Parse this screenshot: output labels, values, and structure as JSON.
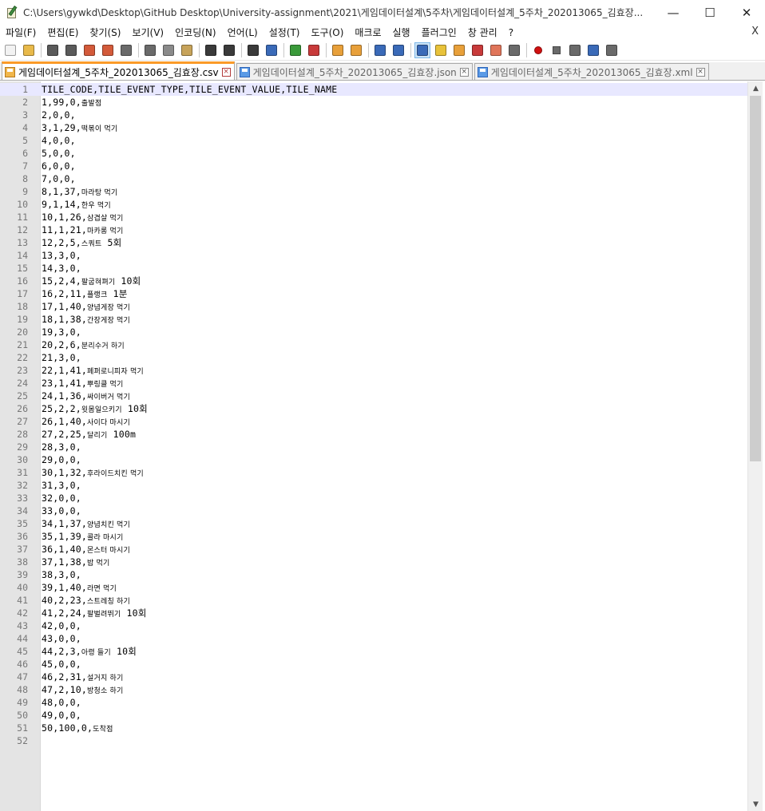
{
  "window": {
    "title": "C:\\Users\\gywkd\\Desktop\\GitHub Desktop\\University-assignment\\2021\\게임데이터설계\\5주차\\게임데이터설계_5주차_202013065_김효장...",
    "minimize": "—",
    "maximize": "☐",
    "close": "✕"
  },
  "menu": {
    "items": [
      "파일(F)",
      "편집(E)",
      "찾기(S)",
      "보기(V)",
      "인코딩(N)",
      "언어(L)",
      "설정(T)",
      "도구(O)",
      "매크로",
      "실행",
      "플러그인",
      "창 관리",
      "?"
    ],
    "close": "X"
  },
  "toolbar": {
    "buttons": [
      {
        "icon": "new-file-icon",
        "color": "#f2f2f2"
      },
      {
        "icon": "open-folder-icon",
        "color": "#e8b94a"
      },
      {
        "icon": "save-icon",
        "color": "#5a5a5a"
      },
      {
        "icon": "save-all-icon",
        "color": "#5a5a5a"
      },
      {
        "icon": "close-file-icon",
        "color": "#d35a3a"
      },
      {
        "icon": "close-all-icon",
        "color": "#d35a3a"
      },
      {
        "icon": "print-icon",
        "color": "#6a6a6a"
      },
      {
        "icon": "cut-icon",
        "color": "#6a6a6a"
      },
      {
        "icon": "copy-icon",
        "color": "#8a8a8a"
      },
      {
        "icon": "paste-icon",
        "color": "#c7a35a"
      },
      {
        "icon": "undo-icon",
        "color": "#3a3a3a"
      },
      {
        "icon": "redo-icon",
        "color": "#3a3a3a"
      },
      {
        "icon": "find-icon",
        "color": "#3a3a3a"
      },
      {
        "icon": "replace-icon",
        "color": "#3a6ab8"
      },
      {
        "icon": "zoom-in-icon",
        "color": "#3a9a3a"
      },
      {
        "icon": "zoom-out-icon",
        "color": "#c83a3a"
      },
      {
        "icon": "sync-vertical-icon",
        "color": "#e8a03a"
      },
      {
        "icon": "sync-horizontal-icon",
        "color": "#e8a03a"
      },
      {
        "icon": "word-wrap-icon",
        "color": "#3a6ab8"
      },
      {
        "icon": "all-characters-icon",
        "color": "#3a6ab8"
      },
      {
        "icon": "indent-guide-icon",
        "color": "#3a6ab8",
        "active": true
      },
      {
        "icon": "user-language-icon",
        "color": "#e8c23a"
      },
      {
        "icon": "document-map-icon",
        "color": "#e8a03a"
      },
      {
        "icon": "function-list-icon",
        "color": "#c83a3a"
      },
      {
        "icon": "folder-workspace-icon",
        "color": "#e0755a"
      },
      {
        "icon": "monitoring-icon",
        "color": "#6a6a6a"
      },
      {
        "icon": "record-macro-icon",
        "color": "#d01010"
      },
      {
        "icon": "stop-record-icon",
        "color": "#6a6a6a"
      },
      {
        "icon": "play-macro-icon",
        "color": "#6a6a6a"
      },
      {
        "icon": "run-macro-multiple-icon",
        "color": "#3a6ab8"
      },
      {
        "icon": "save-macro-icon",
        "color": "#6a6a6a"
      }
    ]
  },
  "tabs": [
    {
      "label": "게임데이터설계_5주차_202013065_김효장.csv",
      "active": true
    },
    {
      "label": "게임데이터설계_5주차_202013065_김효장.json",
      "active": false
    },
    {
      "label": "게임데이터설계_5주차_202013065_김효장.xml",
      "active": false
    }
  ],
  "tab_close": "×",
  "editor": {
    "current_line": 1,
    "lines": [
      {
        "n": "1",
        "ascii": "TILE_CODE,TILE_EVENT_TYPE,TILE_EVENT_VALUE,TILE_NAME",
        "kr": "",
        "tail": ""
      },
      {
        "n": "2",
        "ascii": "1,99,0,",
        "kr": "출발점",
        "tail": ""
      },
      {
        "n": "3",
        "ascii": "2,0,0,",
        "kr": "",
        "tail": ""
      },
      {
        "n": "4",
        "ascii": "3,1,29,",
        "kr": "떡볶이 먹기",
        "tail": ""
      },
      {
        "n": "5",
        "ascii": "4,0,0,",
        "kr": "",
        "tail": ""
      },
      {
        "n": "6",
        "ascii": "5,0,0,",
        "kr": "",
        "tail": ""
      },
      {
        "n": "7",
        "ascii": "6,0,0,",
        "kr": "",
        "tail": ""
      },
      {
        "n": "8",
        "ascii": "7,0,0,",
        "kr": "",
        "tail": ""
      },
      {
        "n": "9",
        "ascii": "8,1,37,",
        "kr": "마라탕 먹기",
        "tail": ""
      },
      {
        "n": "10",
        "ascii": "9,1,14,",
        "kr": "한우 먹기",
        "tail": ""
      },
      {
        "n": "11",
        "ascii": "10,1,26,",
        "kr": "삼겹살 먹기",
        "tail": ""
      },
      {
        "n": "12",
        "ascii": "11,1,21,",
        "kr": "마카롱 먹기",
        "tail": ""
      },
      {
        "n": "13",
        "ascii": "12,2,5,",
        "kr": "스쿼트",
        "tail": " 5회"
      },
      {
        "n": "14",
        "ascii": "13,3,0,",
        "kr": "",
        "tail": ""
      },
      {
        "n": "15",
        "ascii": "14,3,0,",
        "kr": "",
        "tail": ""
      },
      {
        "n": "16",
        "ascii": "15,2,4,",
        "kr": "팔굽혀펴기",
        "tail": " 10회"
      },
      {
        "n": "17",
        "ascii": "16,2,11,",
        "kr": "플랭크",
        "tail": " 1분"
      },
      {
        "n": "18",
        "ascii": "17,1,40,",
        "kr": "양념게장 먹기",
        "tail": ""
      },
      {
        "n": "19",
        "ascii": "18,1,38,",
        "kr": "간장게장 먹기",
        "tail": ""
      },
      {
        "n": "20",
        "ascii": "19,3,0,",
        "kr": "",
        "tail": ""
      },
      {
        "n": "21",
        "ascii": "20,2,6,",
        "kr": "분리수거 하기",
        "tail": ""
      },
      {
        "n": "22",
        "ascii": "21,3,0,",
        "kr": "",
        "tail": ""
      },
      {
        "n": "23",
        "ascii": "22,1,41,",
        "kr": "페퍼로니피자 먹기",
        "tail": ""
      },
      {
        "n": "24",
        "ascii": "23,1,41,",
        "kr": "뿌링클 먹기",
        "tail": ""
      },
      {
        "n": "25",
        "ascii": "24,1,36,",
        "kr": "싸이버거 먹기",
        "tail": ""
      },
      {
        "n": "26",
        "ascii": "25,2,2,",
        "kr": "윗몸일으키기",
        "tail": " 10회"
      },
      {
        "n": "27",
        "ascii": "26,1,40,",
        "kr": "사이다 마시기",
        "tail": ""
      },
      {
        "n": "28",
        "ascii": "27,2,25,",
        "kr": "달리기",
        "tail": " 100m"
      },
      {
        "n": "29",
        "ascii": "28,3,0,",
        "kr": "",
        "tail": ""
      },
      {
        "n": "30",
        "ascii": "29,0,0,",
        "kr": "",
        "tail": ""
      },
      {
        "n": "31",
        "ascii": "30,1,32,",
        "kr": "후라이드치킨 먹기",
        "tail": ""
      },
      {
        "n": "32",
        "ascii": "31,3,0,",
        "kr": "",
        "tail": ""
      },
      {
        "n": "33",
        "ascii": "32,0,0,",
        "kr": "",
        "tail": ""
      },
      {
        "n": "34",
        "ascii": "33,0,0,",
        "kr": "",
        "tail": ""
      },
      {
        "n": "35",
        "ascii": "34,1,37,",
        "kr": "양념치킨 먹기",
        "tail": ""
      },
      {
        "n": "36",
        "ascii": "35,1,39,",
        "kr": "콜라 마시기",
        "tail": ""
      },
      {
        "n": "37",
        "ascii": "36,1,40,",
        "kr": "몬스터 마시기",
        "tail": ""
      },
      {
        "n": "38",
        "ascii": "37,1,38,",
        "kr": "밥 먹기",
        "tail": ""
      },
      {
        "n": "39",
        "ascii": "38,3,0,",
        "kr": "",
        "tail": ""
      },
      {
        "n": "40",
        "ascii": "39,1,40,",
        "kr": "라면 먹기",
        "tail": ""
      },
      {
        "n": "41",
        "ascii": "40,2,23,",
        "kr": "스트레칭 하기",
        "tail": ""
      },
      {
        "n": "42",
        "ascii": "41,2,24,",
        "kr": "팔벌려뛰기",
        "tail": " 10회"
      },
      {
        "n": "43",
        "ascii": "42,0,0,",
        "kr": "",
        "tail": ""
      },
      {
        "n": "44",
        "ascii": "43,0,0,",
        "kr": "",
        "tail": ""
      },
      {
        "n": "45",
        "ascii": "44,2,3,",
        "kr": "아령 들기",
        "tail": " 10회"
      },
      {
        "n": "46",
        "ascii": "45,0,0,",
        "kr": "",
        "tail": ""
      },
      {
        "n": "47",
        "ascii": "46,2,31,",
        "kr": "설거지 하기",
        "tail": ""
      },
      {
        "n": "48",
        "ascii": "47,2,10,",
        "kr": "방청소 하기",
        "tail": ""
      },
      {
        "n": "49",
        "ascii": "48,0,0,",
        "kr": "",
        "tail": ""
      },
      {
        "n": "50",
        "ascii": "49,0,0,",
        "kr": "",
        "tail": ""
      },
      {
        "n": "51",
        "ascii": "50,100,0,",
        "kr": "도착점",
        "tail": ""
      },
      {
        "n": "52",
        "ascii": "",
        "kr": "",
        "tail": ""
      }
    ]
  },
  "scrollbar": {
    "up": "▲",
    "down": "▼"
  }
}
